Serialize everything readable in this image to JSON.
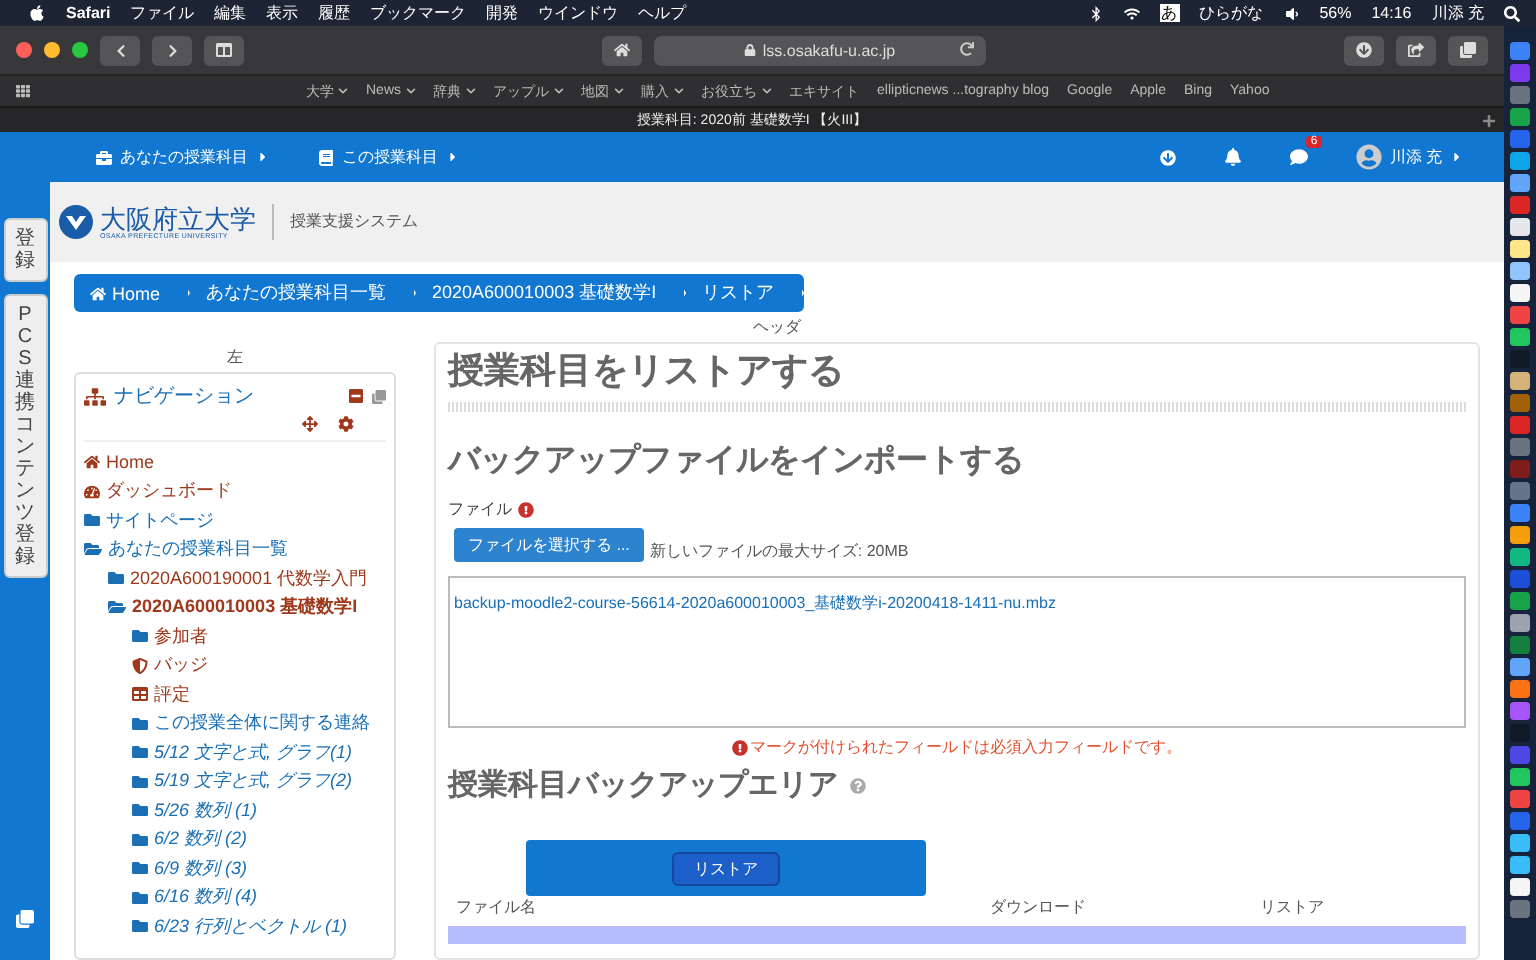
{
  "menubar": {
    "app": "Safari",
    "menus": [
      "ファイル",
      "編集",
      "表示",
      "履歴",
      "ブックマーク",
      "開発",
      "ウインドウ",
      "ヘルプ"
    ],
    "status": {
      "input_char": "あ",
      "input_mode": "ひらがな",
      "battery": "56%",
      "time": "14:16",
      "user": "川添 充"
    }
  },
  "browser": {
    "address": "lss.osakafu-u.ac.jp",
    "bookmarks": [
      {
        "label": "大学",
        "menu": true
      },
      {
        "label": "News",
        "menu": true
      },
      {
        "label": "辞典",
        "menu": true
      },
      {
        "label": "アップル",
        "menu": true
      },
      {
        "label": "地図",
        "menu": true
      },
      {
        "label": "購入",
        "menu": true
      },
      {
        "label": "お役立ち",
        "menu": true
      },
      {
        "label": "エキサイト",
        "menu": false
      },
      {
        "label": "ellipticnews ...tography blog",
        "menu": false
      },
      {
        "label": "Google",
        "menu": false
      },
      {
        "label": "Apple",
        "menu": false
      },
      {
        "label": "Bing",
        "menu": false
      },
      {
        "label": "Yahoo",
        "menu": false
      }
    ],
    "tab_title": "授業科目: 2020前 基礎数学I 【火III】"
  },
  "navbar": {
    "menus": [
      {
        "kind": "courses",
        "label": "あなたの授業科目"
      },
      {
        "kind": "course",
        "label": "この授業科目"
      }
    ],
    "message_count": "6",
    "user": "川添 充"
  },
  "header": {
    "logo_name": "大阪府立大学",
    "logo_sub": "OSAKA PREFECTURE UNIVERSITY",
    "system_name": "授業支援システム"
  },
  "side_tabs": [
    "登録",
    "PCS連携コンテンツ登録"
  ],
  "breadcrumb": [
    "Home",
    "あなたの授業科目一覧",
    "2020A600010003 基礎数学I",
    "リストア"
  ],
  "header_region_label": "ヘッダ",
  "left_region_label": "左",
  "navigation": {
    "title": "ナビゲーション",
    "items": [
      {
        "kind": "home",
        "label": "Home",
        "link": true,
        "current": false
      },
      {
        "kind": "dashboard",
        "label": "ダッシュボード",
        "link": true,
        "current": false
      },
      {
        "kind": "folder",
        "label": "サイトページ",
        "link": false,
        "current": false
      },
      {
        "kind": "folder",
        "label": "あなたの授業科目一覧",
        "link": false,
        "current": false,
        "expanded": true,
        "children": [
          {
            "kind": "folder",
            "label": "2020A600190001 代数学入門",
            "link": true,
            "current": false
          },
          {
            "kind": "folder",
            "label": "2020A600010003 基礎数学I",
            "link": true,
            "current": true,
            "expanded": true,
            "children": [
              {
                "kind": "folder",
                "label": "参加者",
                "link": true,
                "current": false
              },
              {
                "kind": "badge",
                "label": "バッジ",
                "link": true,
                "current": false
              },
              {
                "kind": "grades",
                "label": "評定",
                "link": true,
                "current": false
              },
              {
                "kind": "folder",
                "label": "この授業全体に関する連絡",
                "link": false,
                "current": false
              },
              {
                "kind": "week",
                "label": "5/12 文字と式, グラフ(1)",
                "link": false,
                "current": false
              },
              {
                "kind": "week",
                "label": "5/19 文字と式, グラフ(2)",
                "link": false,
                "current": false
              },
              {
                "kind": "week",
                "label": "5/26 数列 (1)",
                "link": false,
                "current": false
              },
              {
                "kind": "week",
                "label": "6/2 数列 (2)",
                "link": false,
                "current": false
              },
              {
                "kind": "week",
                "label": "6/9 数列 (3)",
                "link": false,
                "current": false
              },
              {
                "kind": "week",
                "label": "6/16 数列 (4)",
                "link": false,
                "current": false
              },
              {
                "kind": "week",
                "label": "6/23 行列とベクトル (1)",
                "link": false,
                "current": false
              }
            ]
          }
        ]
      }
    ]
  },
  "main": {
    "title": "授業科目をリストアする",
    "import_heading": "バックアップファイルをインポートする",
    "file_label": "ファイル",
    "choose_button": "ファイルを選択する ...",
    "max_size": "新しいファイルの最大サイズ: 20MB",
    "file_name": "backup-moodle2-course-56614-2020a600010003_基礎数学i-20200418-1411-nu.mbz",
    "required_note": "マークが付けられたフィールドは必須入力フィールドです。",
    "backup_heading": "授業科目バックアップエリア",
    "columns": [
      "ファイル名",
      "ダウンロード",
      "リストア"
    ]
  },
  "restore_button": "リストア"
}
